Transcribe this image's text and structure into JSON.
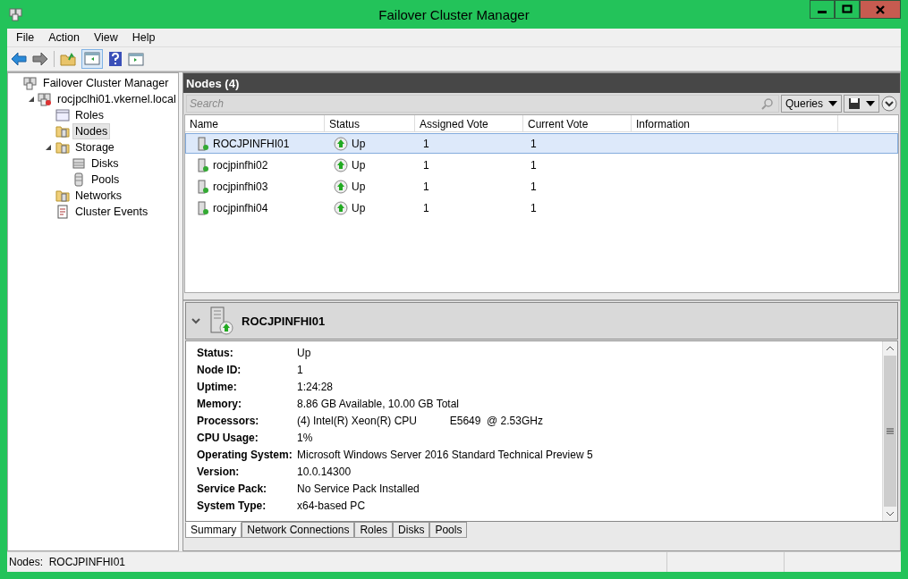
{
  "window": {
    "title": "Failover Cluster Manager"
  },
  "menu": [
    "File",
    "Action",
    "View",
    "Help"
  ],
  "tree": [
    {
      "label": "Failover Cluster Manager",
      "selected": false,
      "children": [
        {
          "label": "rocjpclhi01.vkernel.local",
          "selected": false,
          "expanded": true,
          "children": [
            {
              "label": "Roles",
              "selected": false
            },
            {
              "label": "Nodes",
              "selected": true
            },
            {
              "label": "Storage",
              "selected": false,
              "expanded": true,
              "children": [
                {
                  "label": "Disks",
                  "selected": false
                },
                {
                  "label": "Pools",
                  "selected": false
                }
              ]
            },
            {
              "label": "Networks",
              "selected": false
            },
            {
              "label": "Cluster Events",
              "selected": false
            }
          ]
        }
      ]
    }
  ],
  "panel": {
    "title": "Nodes (4)",
    "search": {
      "placeholder": "Search"
    },
    "queries_button": "Queries"
  },
  "table": {
    "columns": [
      "Name",
      "Status",
      "Assigned Vote",
      "Current Vote",
      "Information"
    ],
    "rows": [
      {
        "name": "ROCJPINFHI01",
        "status": "Up",
        "assigned_vote": "1",
        "current_vote": "1",
        "selected": true
      },
      {
        "name": "rocjpinfhi02",
        "status": "Up",
        "assigned_vote": "1",
        "current_vote": "1",
        "selected": false
      },
      {
        "name": "rocjpinfhi03",
        "status": "Up",
        "assigned_vote": "1",
        "current_vote": "1",
        "selected": false
      },
      {
        "name": "rocjpinfhi04",
        "status": "Up",
        "assigned_vote": "1",
        "current_vote": "1",
        "selected": false
      }
    ]
  },
  "details": {
    "title": "ROCJPINFHI01",
    "expanded": true,
    "fields": [
      {
        "label": "Status:",
        "value": "Up"
      },
      {
        "label": "Node ID:",
        "value": "1"
      },
      {
        "label": "Uptime:",
        "value": "1:24:28"
      },
      {
        "label": "Memory:",
        "value": "8.86 GB Available, 10.00 GB Total"
      },
      {
        "label": "Processors:",
        "value": "(4) Intel(R) Xeon(R) CPU           E5649  @ 2.53GHz"
      },
      {
        "label": "CPU Usage:",
        "value": "1%"
      },
      {
        "label": "Operating System:",
        "value": "Microsoft Windows Server 2016 Standard Technical Preview 5"
      },
      {
        "label": "Version:",
        "value": "10.0.14300"
      },
      {
        "label": "Service Pack:",
        "value": "No Service Pack Installed"
      },
      {
        "label": "System Type:",
        "value": "x64-based PC"
      }
    ],
    "tabs": [
      {
        "label": "Summary",
        "selected": true
      },
      {
        "label": "Network Connections",
        "selected": false
      },
      {
        "label": "Roles",
        "selected": false
      },
      {
        "label": "Disks",
        "selected": false
      },
      {
        "label": "Pools",
        "selected": false
      }
    ]
  },
  "status_bar": {
    "label": "Nodes:",
    "value": "ROCJPINFHI01"
  }
}
